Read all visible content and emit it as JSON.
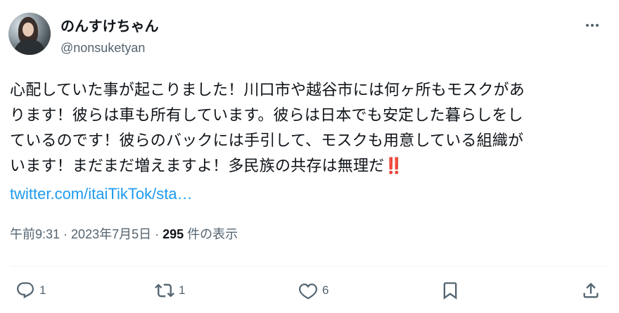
{
  "user": {
    "display_name": "のんすけちゃん",
    "handle": "@nonsuketyan"
  },
  "tweet": {
    "line1": "心配していた事が起こりました！川口市や越谷市には何ヶ所もモスクがあ",
    "line2": "ります！彼らは車も所有しています。彼らは日本でも安定した暮らしをし",
    "line3": "ているのです！彼らのバックには手引して、モスクも用意している組織が",
    "line4": "います！まだまだ増えますよ！多民族の共存は無理だ",
    "emoji": "‼️",
    "link": "twitter.com/itaiTikTok/sta…"
  },
  "meta": {
    "time": "午前9:31",
    "sep1": " · ",
    "date": "2023年7月5日",
    "sep2": " · ",
    "views": "295",
    "views_label": " 件の表示"
  },
  "actions": {
    "reply_count": "1",
    "retweet_count": "1",
    "like_count": "6"
  },
  "icons": {
    "more": "more-horizontal-icon",
    "reply": "reply-icon",
    "retweet": "retweet-icon",
    "like": "heart-icon",
    "bookmark": "bookmark-icon",
    "share": "share-icon"
  },
  "colors": {
    "link": "#1d9bf0",
    "secondary": "#536471",
    "text": "#0f1419",
    "divider": "#eff3f4"
  }
}
